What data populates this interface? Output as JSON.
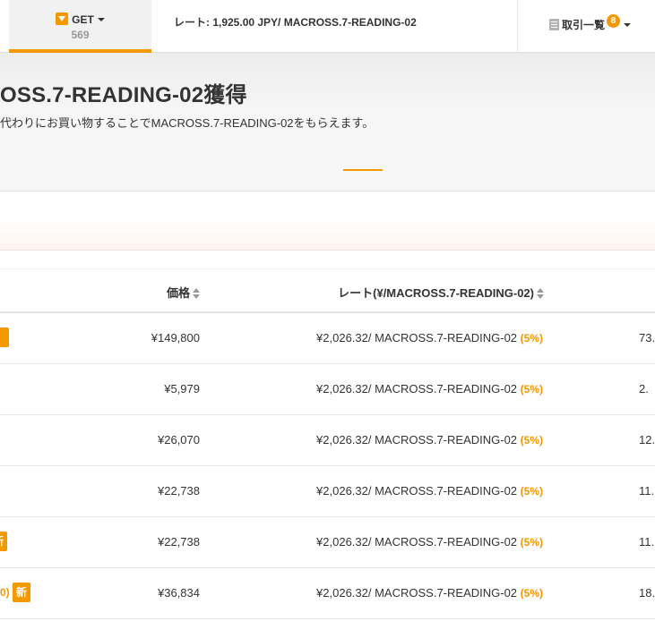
{
  "topnav": {
    "get_label": "GET",
    "get_count": "569",
    "rate": "レート: 1,925.00 JPY/ MACROSS.7-READING-02",
    "tx_label": "取引一覧",
    "tx_badge": "8"
  },
  "hero": {
    "title": "OSS.7-READING-02獲得",
    "subtitle": "代わりにお買い物することでMACROSS.7-READING-02をもらえます。"
  },
  "table": {
    "headers": {
      "price": "価格",
      "rate": "レート(¥/MACROSS.7-READING-02)"
    },
    "rows": [
      {
        "price": "¥149,800",
        "rate": "¥2,026.32/ MACROSS.7-READING-02",
        "pct": "(5%)",
        "amount": "73.",
        "left_badge": ""
      },
      {
        "price": "¥5,979",
        "rate": "¥2,026.32/ MACROSS.7-READING-02",
        "pct": "(5%)",
        "amount": "2.",
        "left_badge": ""
      },
      {
        "price": "¥26,070",
        "rate": "¥2,026.32/ MACROSS.7-READING-02",
        "pct": "(5%)",
        "amount": "12.",
        "left_badge": ""
      },
      {
        "price": "¥22,738",
        "rate": "¥2,026.32/ MACROSS.7-READING-02",
        "pct": "(5%)",
        "amount": "11.",
        "left_badge": ""
      },
      {
        "price": "¥22,738",
        "rate": "¥2,026.32/ MACROSS.7-READING-02",
        "pct": "(5%)",
        "amount": "11.",
        "left_badge": "新"
      },
      {
        "price": "¥36,834",
        "rate": "¥2,026.32/ MACROSS.7-READING-02",
        "pct": "(5%)",
        "amount": "18.",
        "left_badge": "新",
        "left_frag": "0)"
      }
    ]
  },
  "colors": {
    "accent": "#f39800",
    "border": "#e6e6e6",
    "hero_bg": "#f6f6f6"
  }
}
